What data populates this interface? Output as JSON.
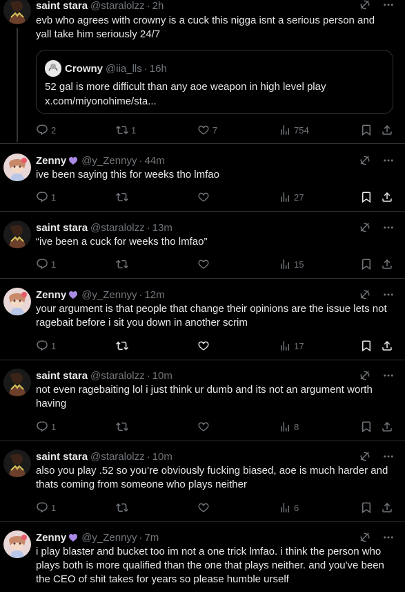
{
  "tweets": [
    {
      "name": "saint stara",
      "handle": "@staralolzz",
      "time": "2h",
      "text": "evb who agrees with crowny is a cuck this nigga isnt a serious person and yall take him seriously 24/7",
      "quote": {
        "name": "Crowny",
        "handle": "@iia_lls",
        "time": "16h",
        "text_line1": "52 gal is more difficult than any aoe weapon in high level play",
        "text_line2": "x.com/miyonohime/sta..."
      },
      "replies": "2",
      "retweets": "1",
      "likes": "7",
      "views": "754"
    },
    {
      "name": "Zenny",
      "handle": "@y_Zennyy",
      "time": "44m",
      "text": "ive been saying this for weeks tho lmfao",
      "replies": "1",
      "retweets": "",
      "likes": "",
      "views": "27"
    },
    {
      "name": "saint stara",
      "handle": "@staralolzz",
      "time": "13m",
      "text": "“ive been a cuck for weeks tho lmfao”",
      "replies": "1",
      "retweets": "",
      "likes": "",
      "views": "15"
    },
    {
      "name": "Zenny",
      "handle": "@y_Zennyy",
      "time": "12m",
      "text": "your argument is that people that change their opinions are the issue lets not ragebait before i sit you down in another scrim",
      "replies": "1",
      "retweets": "",
      "likes": "",
      "views": "17"
    },
    {
      "name": "saint stara",
      "handle": "@staralolzz",
      "time": "10m",
      "text": "not even ragebaiting lol i just think ur dumb and its not an argument worth having",
      "replies": "1",
      "retweets": "",
      "likes": "",
      "views": "8"
    },
    {
      "name": "saint stara",
      "handle": "@staralolzz",
      "time": "10m",
      "text": "also you play .52 so you’re obviously fucking biased, aoe is much harder and thats coming from someone who plays neither",
      "replies": "1",
      "retweets": "",
      "likes": "",
      "views": "6"
    },
    {
      "name": "Zenny",
      "handle": "@y_Zennyy",
      "time": "7m",
      "text": "i play blaster and bucket too im not a one trick lmfao. i think the person who plays both is more qualified than the one that plays neither. and you've been the CEO of shit takes for years so please humble urself"
    }
  ],
  "colors": {
    "background": "#000000",
    "text": "#e7e9ea",
    "muted": "#71767b",
    "border": "#2f3336",
    "badge": "#a98be6"
  },
  "icons": [
    "grok-icon",
    "more-icon",
    "reply-icon",
    "retweet-icon",
    "like-icon",
    "views-icon",
    "bookmark-icon",
    "share-icon",
    "heart-badge-icon"
  ]
}
